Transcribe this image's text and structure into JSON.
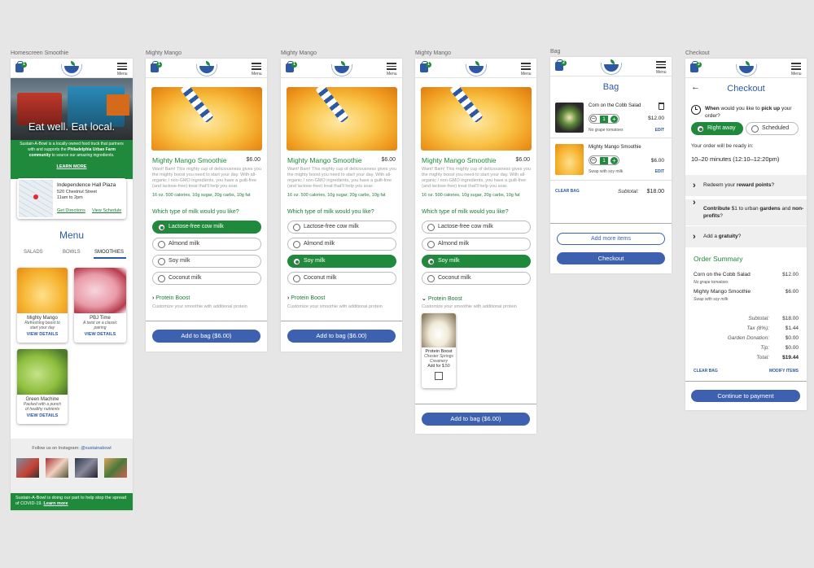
{
  "labels": {
    "home": "Homescreen Smoothie",
    "mm1": "Mighty Mango",
    "mm2": "Mighty Mango",
    "mm3": "Mighty Mango",
    "bag": "Bag",
    "checkout": "Checkout"
  },
  "header": {
    "badge": "1",
    "badge2": "2",
    "menu": "Menu"
  },
  "home": {
    "hero_title": "Eat well. Eat local.",
    "hero_text_1": "Sustain-A-Bowl is a locally owned food truck that partners with and supports the ",
    "hero_text_bold": "Philadelphia Urban Farm community",
    "hero_text_2": " to source our amazing ingredients.",
    "learn_more": "LEARN MORE",
    "location_name": "Independence Hall Plaza",
    "location_addr": "520 Chestnut Street",
    "location_hours": "11am to 2pm",
    "directions": "Get Directions",
    "schedule": "View Schedule",
    "menu_title": "Menu",
    "tabs": [
      "SALADS",
      "BOWLS",
      "SMOOTHIES"
    ],
    "items": [
      {
        "name": "Mighty Mango",
        "sub": "Refreshing boost to start your day",
        "view": "VIEW DETAILS"
      },
      {
        "name": "PBJ Time",
        "sub": "A twist on a classic pairing",
        "view": "VIEW DETAILS"
      },
      {
        "name": "Green Machine",
        "sub": "Packed with a punch of healthy nutrients",
        "view": "VIEW DETAILS"
      }
    ],
    "follow": "Follow us on Instagram: ",
    "handle": "@sustainabowl",
    "footer_text": "Sustain-A-Bowl is doing our part to help stop the spread of COVID-19. ",
    "footer_link": "Learn more"
  },
  "product": {
    "title": "Mighty Mango Smoothie",
    "price": "$6.00",
    "desc": "Want! Bam! This mighty cup of deliciousness gives you the mighty boost you need to start your day. With all-organic / non-GMO ingredients, you have a guilt-free (and lactose-free) treat that'll help you soar.",
    "nutrition": "16 oz. 500 calories, 10g sugar, 20g carbs, 10g fat",
    "question": "Which type of milk would you like?",
    "options": [
      "Lactose-free cow milk",
      "Almond milk",
      "Soy milk",
      "Coconut milk"
    ],
    "boost_title": "Protein Boost",
    "boost_desc": "Customize your smoothie with additional protein",
    "boost_card": {
      "name": "Protein Boost",
      "brand": "Chester Springs Creamery",
      "price": "Add for $.50"
    },
    "add_button": "Add to bag ($6.00)"
  },
  "bag": {
    "title": "Bag",
    "items": [
      {
        "name": "Corn on the Cobb Salad",
        "qty": "1",
        "price": "$12.00",
        "note": "No grape tomatoes",
        "edit": "EDIT"
      },
      {
        "name": "Mighty Mango Smoothie",
        "qty": "1",
        "price": "$6.00",
        "note": "Swap with soy milk",
        "edit": "EDIT"
      }
    ],
    "clear": "CLEAR BAG",
    "subtotal_label": "Subtotal:",
    "subtotal": "$18.00",
    "add_more": "Add more items",
    "checkout": "Checkout"
  },
  "checkout": {
    "title": "Checkout",
    "when_1": "When",
    "when_2": " would you like to ",
    "when_3": "pick up",
    "when_4": " your order?",
    "right_away": "Right away",
    "scheduled": "Scheduled",
    "ready_label": "Your order will be ready in:",
    "ready_time": "10–20 minutes (12:10–12:20pm)",
    "reward_1": "Redeem your ",
    "reward_2": "reward points",
    "reward_3": "?",
    "contrib_1": "Contribute",
    "contrib_2": " $1 to urban ",
    "contrib_3": "gardens",
    "contrib_4": " and ",
    "contrib_5": "non-profits",
    "contrib_6": "?",
    "gratuity_1": "Add a ",
    "gratuity_2": "gratuity",
    "gratuity_3": "?",
    "summary_title": "Order Summary",
    "items": [
      {
        "name": "Corn on the Cobb Salad",
        "note": "No grape tomatoes",
        "price": "$12.00"
      },
      {
        "name": "Mighty Mango Smoothie",
        "note": "Swap with soy milk",
        "price": "$6.00"
      }
    ],
    "totals": [
      {
        "label": "Subtotal:",
        "value": "$18.00"
      },
      {
        "label": "Tax (8%):",
        "value": "$1.44"
      },
      {
        "label": "Garden Donation:",
        "value": "$0.00"
      },
      {
        "label": "Tip:",
        "value": "$0.00"
      },
      {
        "label": "Total:",
        "value": "$19.44"
      }
    ],
    "clear": "CLEAR BAG",
    "modify": "MODIFY ITEMS",
    "continue": "Continue to payment"
  }
}
